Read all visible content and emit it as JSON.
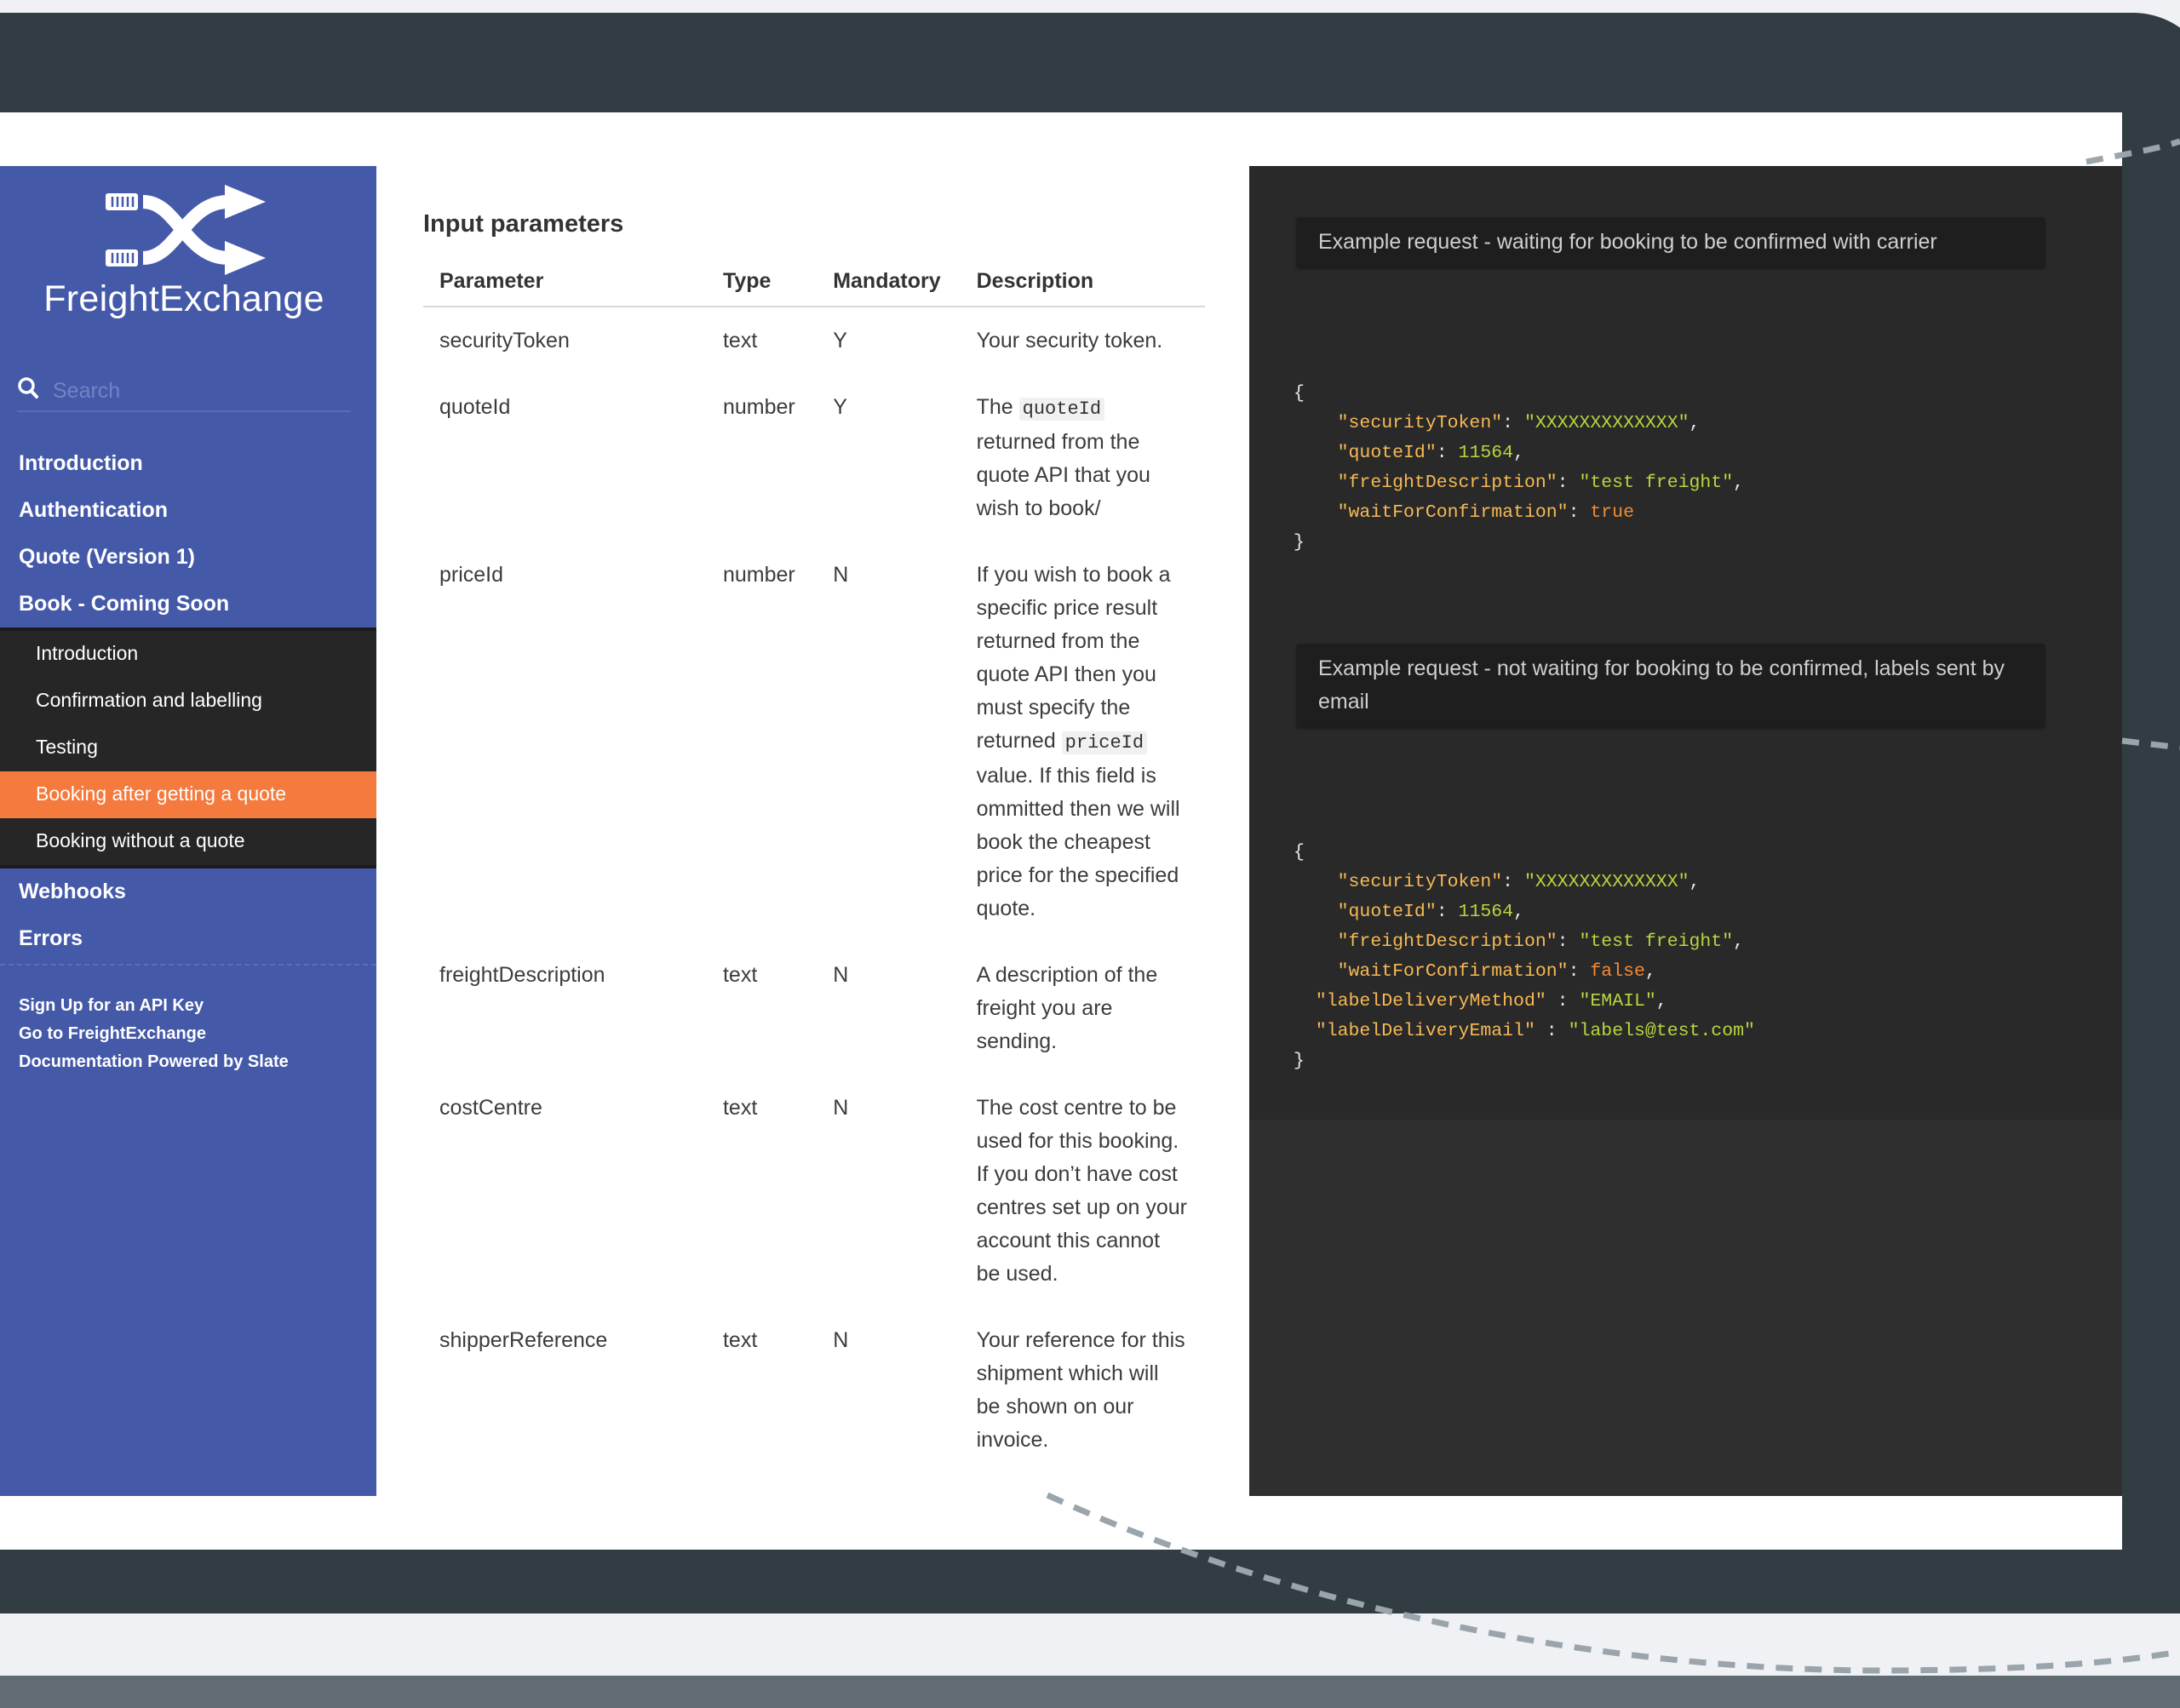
{
  "brand": {
    "name": "FreightExchange"
  },
  "search": {
    "placeholder": "Search"
  },
  "nav": {
    "items_top": [
      "Introduction",
      "Authentication",
      "Quote (Version 1)",
      "Book - Coming Soon"
    ],
    "sub_items": [
      "Introduction",
      "Confirmation and labelling",
      "Testing",
      "Booking after getting a quote",
      "Booking without a quote"
    ],
    "active_sub": "Booking after getting a quote",
    "items_bottom": [
      "Webhooks",
      "Errors"
    ]
  },
  "links": [
    "Sign Up for an API Key",
    "Go to FreightExchange",
    "Documentation Powered by Slate"
  ],
  "content": {
    "heading": "Input parameters",
    "table": {
      "headers": [
        "Parameter",
        "Type",
        "Mandatory",
        "Description"
      ],
      "rows": [
        {
          "parameter": "securityToken",
          "type": "text",
          "mandatory": "Y",
          "description": "Your security token."
        },
        {
          "parameter": "quoteId",
          "type": "number",
          "mandatory": "Y",
          "desc_pre": "The ",
          "desc_code": "quoteId",
          "desc_post": " returned from the quote API that you wish to book/"
        },
        {
          "parameter": "priceId",
          "type": "number",
          "mandatory": "N",
          "desc_pre": "If you wish to book a specific price result returned from the quote API then you must specify the returned ",
          "desc_code": "priceId",
          "desc_post": " value. If this field is ommitted then we will book the cheapest price for the specified quote."
        },
        {
          "parameter": "freightDescription",
          "type": "text",
          "mandatory": "N",
          "description": "A description of the freight you are sending."
        },
        {
          "parameter": "costCentre",
          "type": "text",
          "mandatory": "N",
          "description": "The cost centre to be used for this booking. If you don’t have cost centres set up on your account this cannot be used."
        },
        {
          "parameter": "shipperReference",
          "type": "text",
          "mandatory": "N",
          "description": "Your reference for this shipment which will be shown on our invoice."
        }
      ]
    }
  },
  "examples": [
    {
      "label": "Example request - waiting for booking to be confirmed with carrier",
      "security_token": "XXXXXXXXXXXXX",
      "quote_id": "11564",
      "freight_description": "test freight",
      "wait_for_confirmation": "true"
    },
    {
      "label": "Example request - not waiting for booking to be confirmed, labels sent by email",
      "security_token": "XXXXXXXXXXXXX",
      "quote_id": "11564",
      "freight_description": "test freight",
      "wait_for_confirmation": "false",
      "label_delivery_method": "EMAIL",
      "label_delivery_email": "labels@test.com"
    }
  ],
  "colors": {
    "sidebar": "#4559a9",
    "active": "#f47a3d",
    "code_bg": "#292929",
    "code_key": "#f7b955",
    "code_string": "#b5d73e",
    "code_bool": "#f38b36"
  }
}
